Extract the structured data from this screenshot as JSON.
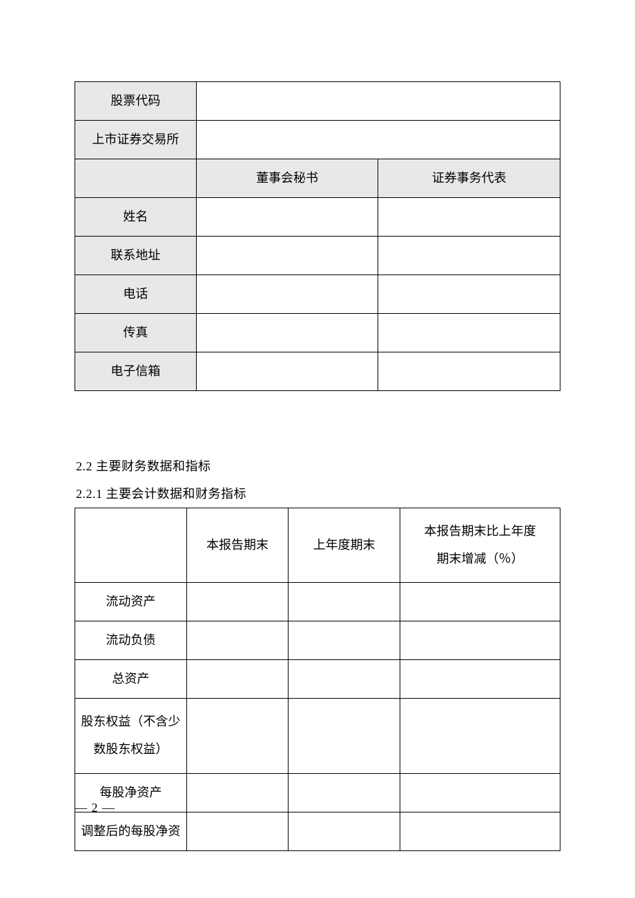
{
  "table1": {
    "rows": {
      "stock_code": "股票代码",
      "exchange": "上市证券交易所",
      "secretary": "董事会秘书",
      "rep": "证券事务代表",
      "name": "姓名",
      "address": "联系地址",
      "phone": "电话",
      "fax": "传真",
      "email": "电子信箱"
    }
  },
  "section": {
    "h22": "2.2 主要财务数据和指标",
    "h221": "2.2.1 主要会计数据和财务指标"
  },
  "table2": {
    "headers": {
      "c2": "本报告期末",
      "c3": "上年度期末",
      "c4_line1": "本报告期末比上年度",
      "c4_line2": "期末增减（％）"
    },
    "rows": {
      "r1": "流动资产",
      "r2": "流动负债",
      "r3": "总资产",
      "r4_line1": "股东权益（不含少",
      "r4_line2": "数股东权益）",
      "r5": "每股净资产",
      "r6": "调整后的每股净资"
    }
  },
  "footer": {
    "page": "— 2 —"
  }
}
